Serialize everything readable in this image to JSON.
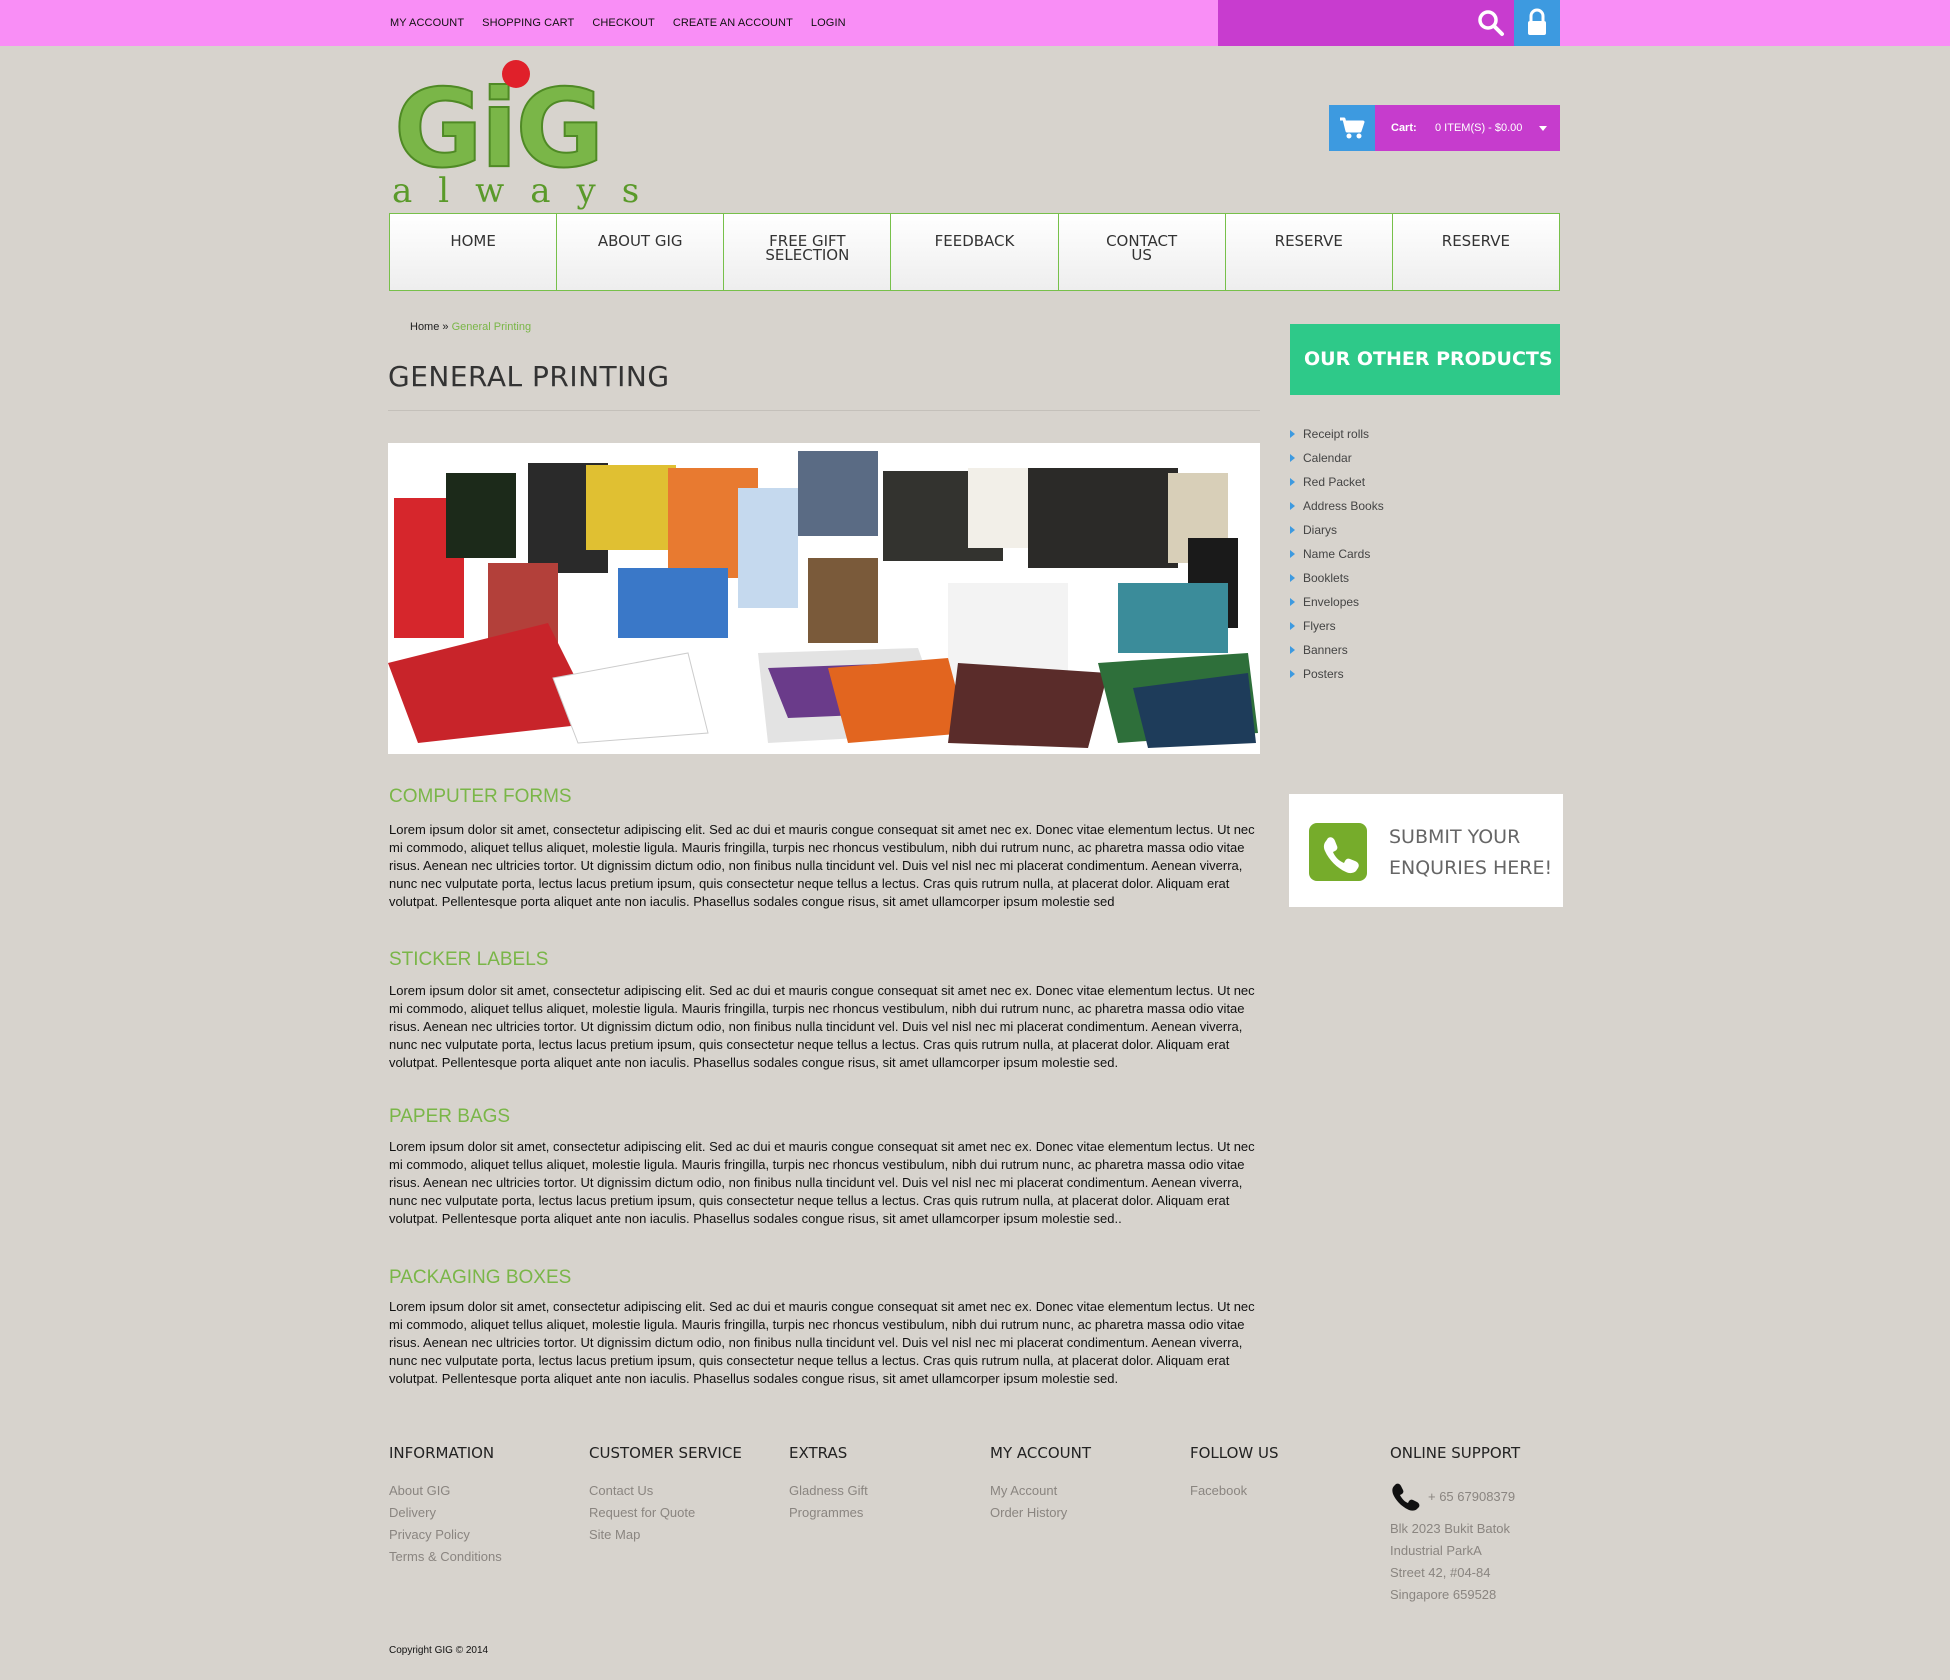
{
  "topbar": {
    "links": [
      "MY ACCOUNT",
      "SHOPPING CART",
      "CHECKOUT",
      "CREATE AN ACCOUNT",
      "LOGIN"
    ]
  },
  "logo": {
    "line1": "GiG",
    "line2": "always"
  },
  "cart": {
    "label": "Cart:",
    "summary": "0 ITEM(S) - $0.00"
  },
  "nav": [
    {
      "line1": "HOME",
      "line2": ""
    },
    {
      "line1": "ABOUT GIG",
      "line2": ""
    },
    {
      "line1": "FREE GIFT",
      "line2": "SELECTION"
    },
    {
      "line1": "FEEDBACK",
      "line2": ""
    },
    {
      "line1": "CONTACT",
      "line2": "US"
    },
    {
      "line1": "RESERVE",
      "line2": ""
    },
    {
      "line1": "RESERVE",
      "line2": ""
    }
  ],
  "breadcrumb": {
    "home": "Home",
    "sep": " » ",
    "current": "General Printing"
  },
  "page": {
    "title": "GENERAL PRINTING",
    "sections": [
      {
        "title": "COMPUTER FORMS",
        "body": "Lorem ipsum dolor sit amet, consectetur adipiscing elit. Sed ac dui et mauris congue consequat sit amet nec ex. Donec vitae elementum lectus. Ut nec mi commodo, aliquet tellus aliquet, molestie ligula. Mauris fringilla, turpis nec rhoncus vestibulum, nibh dui rutrum nunc, ac pharetra massa odio vitae risus. Aenean nec ultricies tortor. Ut dignissim dictum odio, non finibus nulla tincidunt vel. Duis vel nisl nec mi placerat condimentum. Aenean viverra, nunc nec vulputate porta, lectus lacus pretium ipsum, quis consectetur neque tellus a lectus. Cras quis rutrum nulla, at placerat dolor. Aliquam erat volutpat. Pellentesque porta aliquet ante non iaculis. Phasellus sodales congue risus, sit amet ullamcorper ipsum molestie sed"
      },
      {
        "title": "STICKER LABELS",
        "body": "Lorem ipsum dolor sit amet, consectetur adipiscing elit. Sed ac dui et mauris congue consequat sit amet nec ex. Donec vitae elementum lectus. Ut nec mi commodo, aliquet tellus aliquet, molestie ligula. Mauris fringilla, turpis nec rhoncus vestibulum, nibh dui rutrum nunc, ac pharetra massa odio vitae risus. Aenean nec ultricies tortor. Ut dignissim dictum odio, non finibus nulla tincidunt vel. Duis vel nisl nec mi placerat condimentum. Aenean viverra, nunc nec vulputate porta, lectus lacus pretium ipsum, quis consectetur neque tellus a lectus. Cras quis rutrum nulla, at placerat dolor. Aliquam erat volutpat. Pellentesque porta aliquet ante non iaculis. Phasellus sodales congue risus, sit amet ullamcorper ipsum molestie sed."
      },
      {
        "title": "PAPER BAGS",
        "body": "Lorem ipsum dolor sit amet, consectetur adipiscing elit. Sed ac dui et mauris congue consequat sit amet nec ex. Donec vitae elementum lectus. Ut nec mi commodo, aliquet tellus aliquet, molestie ligula. Mauris fringilla, turpis nec rhoncus vestibulum, nibh dui rutrum nunc, ac pharetra massa odio vitae risus. Aenean nec ultricies tortor. Ut dignissim dictum odio, non finibus nulla tincidunt vel. Duis vel nisl nec mi placerat condimentum. Aenean viverra, nunc nec vulputate porta, lectus lacus pretium ipsum, quis consectetur neque tellus a lectus. Cras quis rutrum nulla, at placerat dolor. Aliquam erat volutpat. Pellentesque porta aliquet ante non iaculis. Phasellus sodales congue risus, sit amet ullamcorper ipsum molestie sed.."
      },
      {
        "title": "PACKAGING BOXES",
        "body": "Lorem ipsum dolor sit amet, consectetur adipiscing elit. Sed ac dui et mauris congue consequat sit amet nec ex. Donec vitae elementum lectus. Ut nec mi commodo, aliquet tellus aliquet, molestie ligula. Mauris fringilla, turpis nec rhoncus vestibulum, nibh dui rutrum nunc, ac pharetra massa odio vitae risus. Aenean nec ultricies tortor. Ut dignissim dictum odio, non finibus nulla tincidunt vel. Duis vel nisl nec mi placerat condimentum. Aenean viverra, nunc nec vulputate porta, lectus lacus pretium ipsum, quis consectetur neque tellus a lectus. Cras quis rutrum nulla, at placerat dolor. Aliquam erat volutpat. Pellentesque porta aliquet ante non iaculis. Phasellus sodales congue risus, sit amet ullamcorper ipsum molestie sed."
      }
    ]
  },
  "sidebar": {
    "heading": "OUR OTHER PRODUCTS",
    "items": [
      "Receipt rolls",
      "Calendar",
      "Red Packet",
      "Address Books",
      "Diarys",
      "Name Cards",
      "Booklets",
      "Envelopes",
      "Flyers",
      "Banners",
      "Posters"
    ],
    "enquiry": {
      "line1": "SUBMIT YOUR",
      "line2": "ENQURIES HERE!"
    }
  },
  "footer": {
    "information": {
      "title": "INFORMATION",
      "links": [
        "About GIG",
        "Delivery",
        "Privacy Policy",
        "Terms & Conditions"
      ]
    },
    "customer_service": {
      "title": "CUSTOMER SERVICE",
      "links": [
        "Contact Us",
        "Request for Quote",
        "Site Map"
      ]
    },
    "extras": {
      "title": "EXTRAS",
      "links": [
        "Gladness Gift",
        "Programmes"
      ]
    },
    "my_account": {
      "title": "MY ACCOUNT",
      "links": [
        "My Account",
        "Order History"
      ]
    },
    "follow_us": {
      "title": "FOLLOW US",
      "links": [
        "Facebook"
      ]
    },
    "online_support": {
      "title": "ONLINE SUPPORT",
      "phone": "+ 65 67908379",
      "address": [
        "Blk 2023 Bukit Batok",
        "Industrial ParkA",
        "Street 42, #04-84",
        "Singapore 659528"
      ]
    },
    "copyright": "Copyright GIG © 2014"
  },
  "colors": {
    "topbar": "#f98ef6",
    "magenta": "#c63ccd",
    "blue": "#3d9ae0",
    "green": "#7ab648",
    "teal": "#2ec989",
    "logo_red": "#e0202a",
    "background": "#d7d3cd"
  },
  "icons": [
    "search-icon",
    "lock-icon",
    "cart-icon",
    "phone-icon",
    "caret-down-icon",
    "bullet-arrow-icon"
  ]
}
